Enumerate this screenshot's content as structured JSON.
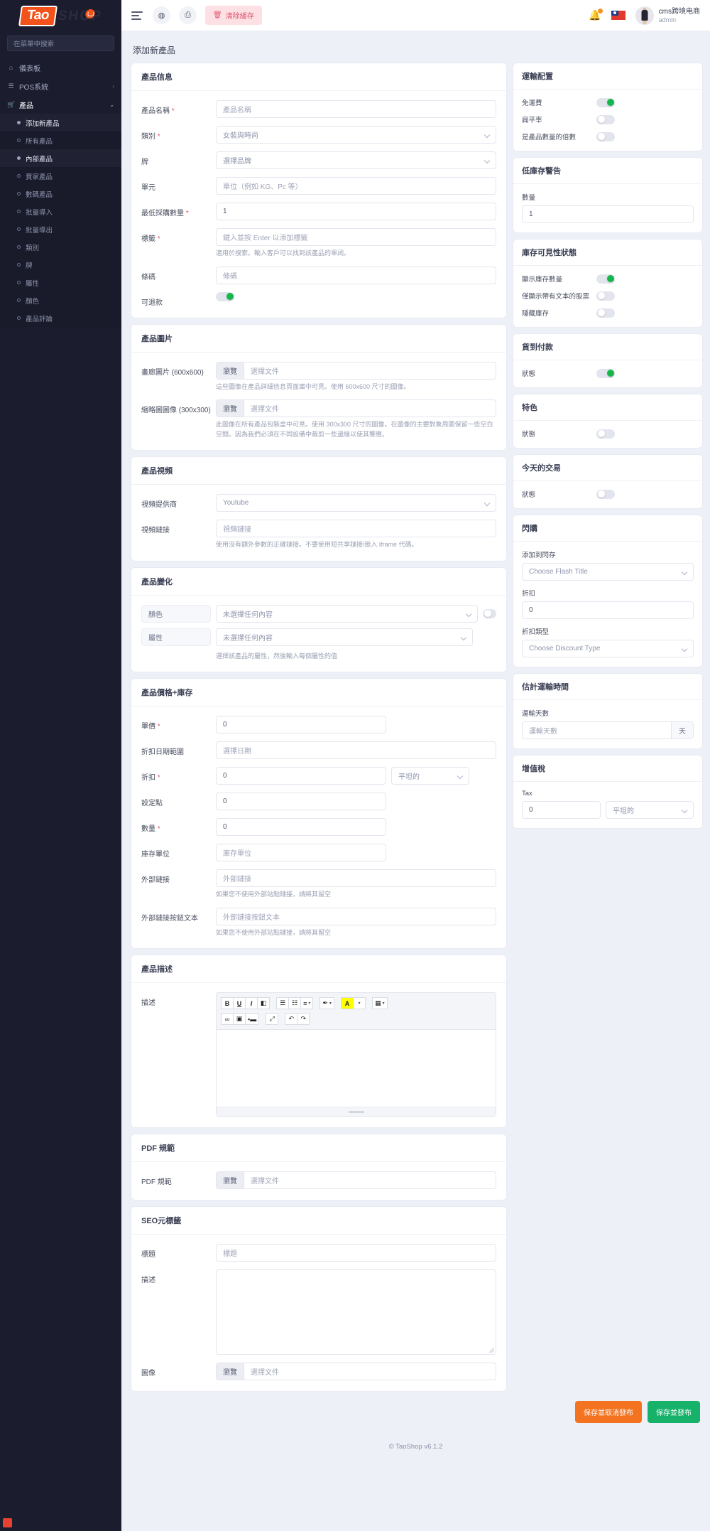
{
  "brand": {
    "tao": "Tao",
    "shop": "SHOP"
  },
  "sidebar": {
    "search_placeholder": "在菜單中搜索",
    "items": [
      {
        "label": "儀表板",
        "icon": "home-icon"
      },
      {
        "label": "POS系統",
        "icon": "list-icon",
        "caret": "›"
      },
      {
        "label": "產品",
        "icon": "cart-icon",
        "caret": "⌄"
      }
    ],
    "sub_items": [
      {
        "label": "添加新產品",
        "active": true
      },
      {
        "label": "所有產品",
        "active": false
      },
      {
        "label": "內部產品",
        "active": true
      },
      {
        "label": "賣家產品",
        "active": false
      },
      {
        "label": "數碼產品",
        "active": false
      },
      {
        "label": "批量導入",
        "active": false
      },
      {
        "label": "批量導出",
        "active": false
      },
      {
        "label": "類別",
        "active": false
      },
      {
        "label": "牌",
        "active": false
      },
      {
        "label": "屬性",
        "active": false
      },
      {
        "label": "顏色",
        "active": false
      },
      {
        "label": "產品評論",
        "active": false
      }
    ]
  },
  "topbar": {
    "clear_cache": "清除緩存",
    "user_name": "cms跨境电商",
    "user_role": "admin"
  },
  "page_title": "添加新產品",
  "product_info": {
    "title": "產品信息",
    "name_label": "產品名稱",
    "name_placeholder": "產品名稱",
    "category_label": "類別",
    "category_value": "女裝與時尚",
    "brand_label": "牌",
    "brand_placeholder": "選擇品牌",
    "unit_label": "單元",
    "unit_placeholder": "單位（例如 KG、Pc 等）",
    "minqty_label": "最低採購數量",
    "minqty_value": "1",
    "tags_label": "標籤",
    "tags_placeholder": "鍵入並按 Enter 以添加標籤",
    "tags_hint": "適用於搜索。輸入客戶可以找到該產品的單詞。",
    "barcode_label": "條碼",
    "barcode_placeholder": "條碼",
    "refundable_label": "可退款"
  },
  "product_images": {
    "title": "產品圖片",
    "gallery_label": "畫廊圖片 (600x600)",
    "gallery_hint": "這些圖像在產品詳細信息頁面庫中可見。使用 600x600 尺寸的圖像。",
    "thumb_label": "縮略圖圖像 (300x300)",
    "thumb_hint": "此圖像在所有產品包裝盒中可見。使用 300x300 尺寸的圖像。在圖像的主要對象周圍保留一些空白空間。因為我們必須在不同設備中裁剪一些邊緣以使其響應。",
    "browse": "瀏覽",
    "choose_file": "選擇文件"
  },
  "product_video": {
    "title": "產品視頻",
    "provider_label": "視頻提供商",
    "provider_value": "Youtube",
    "link_label": "視頻鏈接",
    "link_placeholder": "視頻鏈接",
    "hint": "使用沒有額外參數的正確鏈接。不要使用短共享鏈接/嵌入 iframe 代碼。"
  },
  "product_variation": {
    "title": "產品變化",
    "color_tag": "顏色",
    "color_placeholder": "未選擇任何內容",
    "attr_tag": "屬性",
    "attr_placeholder": "未選擇任何內容",
    "hint": "選擇該產品的屬性，然後輸入每個屬性的值"
  },
  "price_stock": {
    "title": "產品價格+庫存",
    "unit_price_label": "單價",
    "unit_price_value": "0",
    "date_range_label": "折扣日期範圍",
    "date_range_placeholder": "選擇日期",
    "discount_label": "折扣",
    "discount_value": "0",
    "discount_type": "平坦的",
    "setpoint_label": "設定點",
    "setpoint_value": "0",
    "qty_label": "數量",
    "qty_value": "0",
    "sku_label": "庫存單位",
    "sku_placeholder": "庫存單位",
    "ext_link_label": "外部鏈接",
    "ext_link_placeholder": "外部鏈接",
    "ext_link_hint": "如果您不使用外部站點鏈接，請將其留空",
    "ext_btn_label": "外部鏈接按鈕文本",
    "ext_btn_placeholder": "外部鏈接按鈕文本",
    "ext_btn_hint": "如果您不使用外部站點鏈接，請將其留空"
  },
  "description": {
    "title": "產品描述",
    "label": "描述",
    "toolbar_row1": [
      {
        "name": "bold-icon",
        "glyph": "B",
        "style": "bold"
      },
      {
        "name": "underline-icon",
        "glyph": "U",
        "style": "underline"
      },
      {
        "name": "italic-icon",
        "glyph": "I",
        "style": "italic"
      },
      {
        "name": "eraser-icon",
        "glyph": "◧",
        "style": "plain"
      },
      {
        "name": "unordered-list-icon",
        "glyph": "☰",
        "style": "plain"
      },
      {
        "name": "ordered-list-icon",
        "glyph": "☷",
        "style": "plain"
      },
      {
        "name": "align-icon",
        "glyph": "≡",
        "style": "caret"
      },
      {
        "name": "magic-style-icon",
        "glyph": "✒",
        "style": "caret"
      },
      {
        "name": "font-color-icon",
        "glyph": "A",
        "style": "highlight-caret"
      },
      {
        "name": "table-icon",
        "glyph": "▦",
        "style": "caret"
      }
    ],
    "toolbar_row2": [
      {
        "name": "link-icon",
        "glyph": "∞",
        "style": "plain"
      },
      {
        "name": "image-icon",
        "glyph": "▣",
        "style": "plain"
      },
      {
        "name": "video-icon",
        "glyph": "▪▬",
        "style": "plain"
      },
      {
        "name": "fullscreen-icon",
        "glyph": "⤢",
        "style": "plain"
      },
      {
        "name": "undo-icon",
        "glyph": "↶",
        "style": "plain"
      },
      {
        "name": "redo-icon",
        "glyph": "↷",
        "style": "plain"
      }
    ]
  },
  "pdf": {
    "title": "PDF 規範",
    "label": "PDF 規範",
    "browse": "瀏覽",
    "choose_file": "選擇文件"
  },
  "seo": {
    "title": "SEO元標籤",
    "title_label": "標題",
    "title_placeholder": "標題",
    "desc_label": "描述",
    "image_label": "圖像",
    "browse": "瀏覽",
    "choose_file": "選擇文件"
  },
  "shipping_config": {
    "title": "運輸配置",
    "free_label": "免運費",
    "free_on": true,
    "flat_label": "扁平率",
    "flat_on": false,
    "multiply_label": "是產品數量的倍數",
    "multiply_on": false
  },
  "low_stock": {
    "title": "低庫存警告",
    "qty_label": "數量",
    "qty_value": "1"
  },
  "stock_visibility": {
    "title": "庫存可見性狀態",
    "show_qty_label": "顯示庫存數量",
    "show_qty_on": true,
    "text_only_label": "僅顯示帶有文本的股票",
    "text_only_on": false,
    "hide_label": "隱藏庫存",
    "hide_on": false
  },
  "cod": {
    "title": "貨到付款",
    "status_label": "狀態",
    "status_on": true
  },
  "featured": {
    "title": "特色",
    "status_label": "狀態",
    "status_on": false
  },
  "todays_deal": {
    "title": "今天的交易",
    "status_label": "狀態",
    "status_on": false
  },
  "flash_deal": {
    "title": "閃購",
    "add_label": "添加到閃存",
    "add_placeholder": "Choose Flash Title",
    "discount_label": "折扣",
    "discount_value": "0",
    "type_label": "折扣類型",
    "type_placeholder": "Choose Discount Type"
  },
  "shipping_time": {
    "title": "估計運輸時間",
    "days_label": "運輸天數",
    "days_placeholder": "運輸天數",
    "days_suffix": "天"
  },
  "vat": {
    "title": "增值稅",
    "tax_label": "Tax",
    "tax_value": "0",
    "tax_type": "平坦的"
  },
  "actions": {
    "save_unpublish": "保存並取消發布",
    "save_publish": "保存並發布"
  },
  "footer": "© TaoShop v6.1.2",
  "colors": {
    "accent_orange": "#f4521b",
    "green": "#14b74b",
    "pink": "#fde0e4",
    "sidebar": "#1b1d2e"
  }
}
